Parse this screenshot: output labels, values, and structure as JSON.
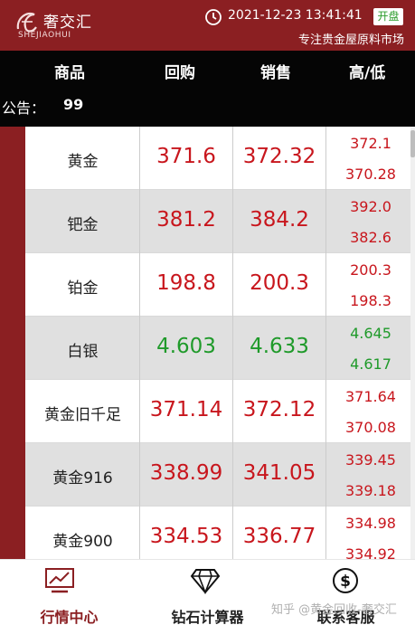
{
  "header": {
    "logo_text": "奢交汇",
    "logo_sub": "SHEJIAOHUI",
    "datetime": "2021-12-23 13:41:41",
    "status_badge": "开盘",
    "tagline": "专注贵金屋原料市场"
  },
  "columns": {
    "name": "商品",
    "buy": "回购",
    "sell": "销售",
    "highlow": "高/低"
  },
  "notice": {
    "label": "公告：",
    "text": "99"
  },
  "rows": [
    {
      "name": "黄金",
      "buy": "371.6",
      "sell": "372.32",
      "high": "372.1",
      "low": "370.28",
      "trend": "up"
    },
    {
      "name": "钯金",
      "buy": "381.2",
      "sell": "384.2",
      "high": "392.0",
      "low": "382.6",
      "trend": "up"
    },
    {
      "name": "铂金",
      "buy": "198.8",
      "sell": "200.3",
      "high": "200.3",
      "low": "198.3",
      "trend": "up"
    },
    {
      "name": "白银",
      "buy": "4.603",
      "sell": "4.633",
      "high": "4.645",
      "low": "4.617",
      "trend": "down"
    },
    {
      "name": "黄金旧千足",
      "buy": "371.14",
      "sell": "372.12",
      "high": "371.64",
      "low": "370.08",
      "trend": "up"
    },
    {
      "name": "黄金916",
      "buy": "338.99",
      "sell": "341.05",
      "high": "339.45",
      "low": "339.18",
      "trend": "up"
    },
    {
      "name": "黄金900",
      "buy": "334.53",
      "sell": "336.77",
      "high": "334.98",
      "low": "334.92",
      "trend": "up"
    }
  ],
  "nav": {
    "market": "行情中心",
    "calculator": "钻石计算器",
    "contact": "联系客服"
  },
  "watermark": "知乎 @黄金回收-奢交汇",
  "colors": {
    "brand": "#8b1f22",
    "up": "#c8161d",
    "down": "#1f9a2a"
  }
}
